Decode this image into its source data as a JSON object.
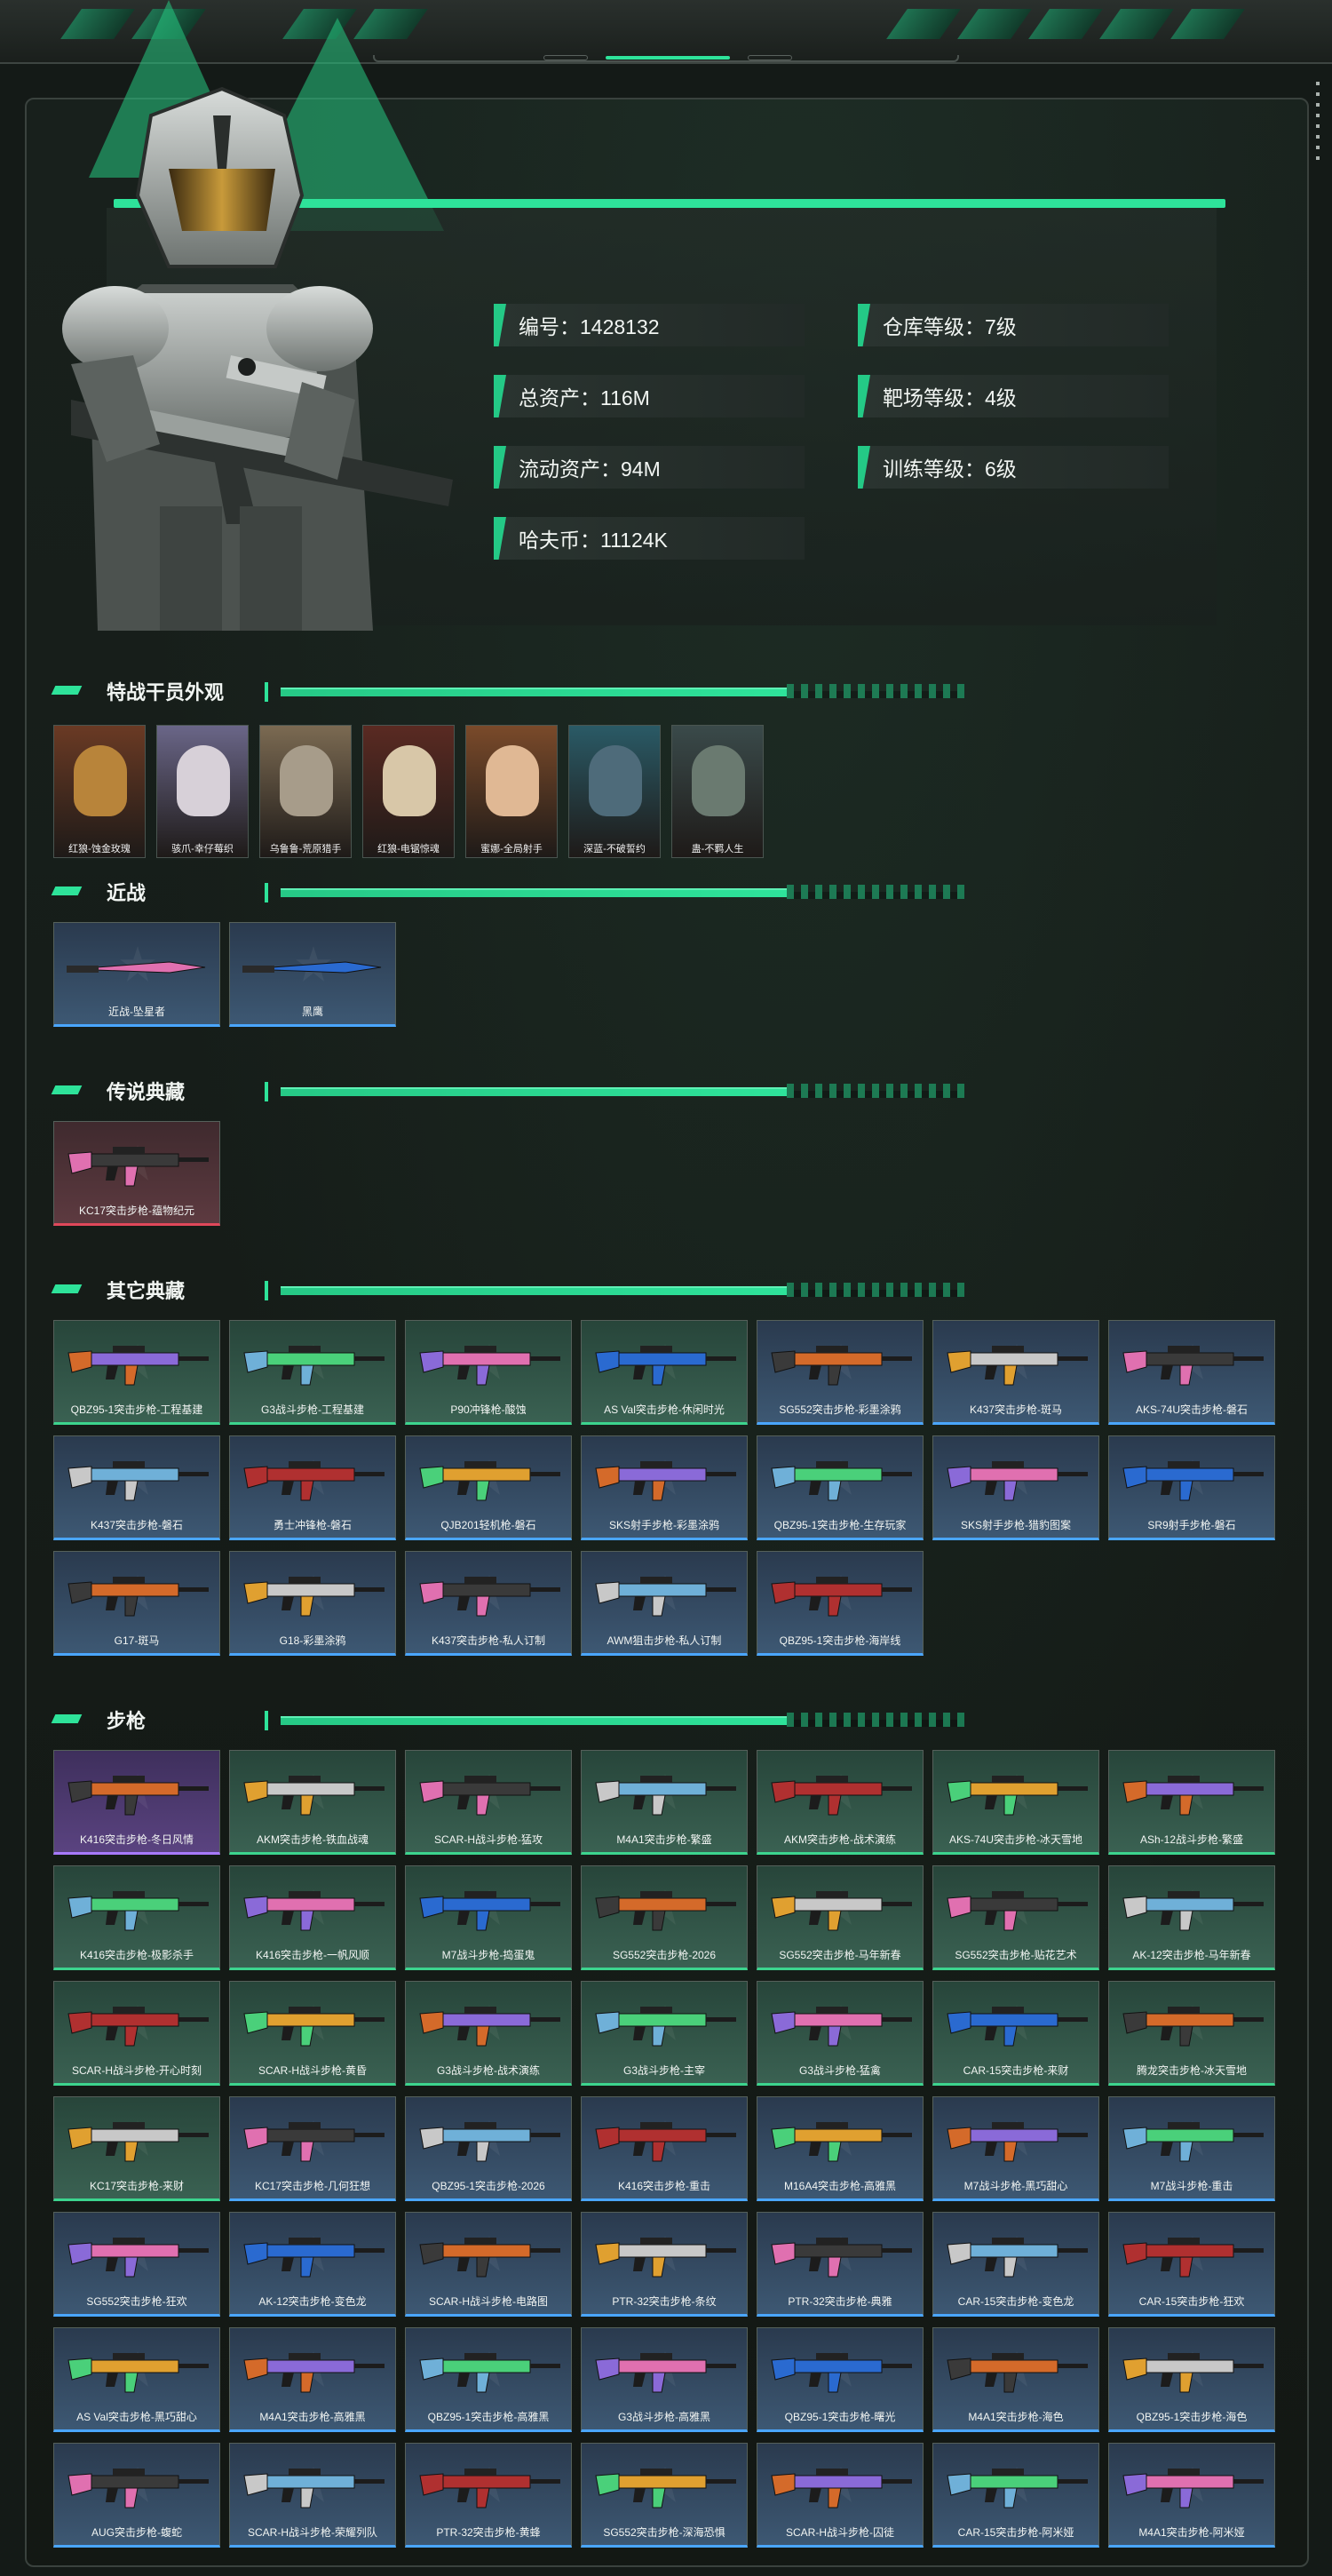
{
  "profile": {
    "stats": [
      {
        "label": "编号：1428132"
      },
      {
        "label": "仓库等级：7级"
      },
      {
        "label": "总资产：116M"
      },
      {
        "label": "靶场等级：4级"
      },
      {
        "label": "流动资产：94M"
      },
      {
        "label": "训练等级：6级"
      },
      {
        "label": "哈夫币：11124K"
      }
    ]
  },
  "sections": {
    "operators": {
      "title": "特战干员外观"
    },
    "melee": {
      "title": "近战"
    },
    "legend": {
      "title": "传说典藏"
    },
    "other": {
      "title": "其它典藏"
    },
    "rifles": {
      "title": "步枪"
    }
  },
  "operators": [
    {
      "name": "红狼-蚀金玫瑰"
    },
    {
      "name": "骇爪-幸仔莓织"
    },
    {
      "name": "乌鲁鲁-荒原猎手"
    },
    {
      "name": "红狼-电锯惊魂"
    },
    {
      "name": "蜜娜-全局射手"
    },
    {
      "name": "深蓝-不破誓约"
    },
    {
      "name": "蛊-不羁人生"
    }
  ],
  "melee": [
    {
      "name": "近战-坠星者",
      "rarity": "blue"
    },
    {
      "name": "黑鹰",
      "rarity": "blue"
    }
  ],
  "legend": [
    {
      "name": "KC17突击步枪-蕴物纪元",
      "rarity": "red"
    }
  ],
  "other": [
    {
      "name": "QBZ95-1突击步枪-工程基建",
      "rarity": "green"
    },
    {
      "name": "G3战斗步枪-工程基建",
      "rarity": "green"
    },
    {
      "name": "P90冲锋枪-酸蚀",
      "rarity": "green"
    },
    {
      "name": "AS Val突击步枪-休闲时光",
      "rarity": "green"
    },
    {
      "name": "SG552突击步枪-彩墨涂鸦",
      "rarity": "blue"
    },
    {
      "name": "K437突击步枪-斑马",
      "rarity": "blue"
    },
    {
      "name": "AKS-74U突击步枪-磐石",
      "rarity": "blue"
    },
    {
      "name": "K437突击步枪-磐石",
      "rarity": "blue"
    },
    {
      "name": "勇士冲锋枪-磐石",
      "rarity": "blue"
    },
    {
      "name": "QJB201轻机枪-磐石",
      "rarity": "blue"
    },
    {
      "name": "SKS射手步枪-彩墨涂鸦",
      "rarity": "blue"
    },
    {
      "name": "QBZ95-1突击步枪-生存玩家",
      "rarity": "blue"
    },
    {
      "name": "SKS射手步枪-猎豹图案",
      "rarity": "blue"
    },
    {
      "name": "SR9射手步枪-磐石",
      "rarity": "blue"
    },
    {
      "name": "G17-斑马",
      "rarity": "blue"
    },
    {
      "name": "G18-彩墨涂鸦",
      "rarity": "blue"
    },
    {
      "name": "K437突击步枪-私人订制",
      "rarity": "blue"
    },
    {
      "name": "AWM狙击步枪-私人订制",
      "rarity": "blue"
    },
    {
      "name": "QBZ95-1突击步枪-海岸线",
      "rarity": "blue"
    }
  ],
  "rifles": [
    {
      "name": "K416突击步枪-冬日风情",
      "rarity": "purple"
    },
    {
      "name": "AKM突击步枪-铁血战魂",
      "rarity": "green"
    },
    {
      "name": "SCAR-H战斗步枪-猛攻",
      "rarity": "green"
    },
    {
      "name": "M4A1突击步枪-繁盛",
      "rarity": "green"
    },
    {
      "name": "AKM突击步枪-战术演练",
      "rarity": "green"
    },
    {
      "name": "AKS-74U突击步枪-冰天雪地",
      "rarity": "green"
    },
    {
      "name": "ASh-12战斗步枪-繁盛",
      "rarity": "green"
    },
    {
      "name": "K416突击步枪-极影杀手",
      "rarity": "green"
    },
    {
      "name": "K416突击步枪-一帆风顺",
      "rarity": "green"
    },
    {
      "name": "M7战斗步枪-捣蛋鬼",
      "rarity": "green"
    },
    {
      "name": "SG552突击步枪-2026",
      "rarity": "green"
    },
    {
      "name": "SG552突击步枪-马年新春",
      "rarity": "green"
    },
    {
      "name": "SG552突击步枪-贴花艺术",
      "rarity": "green"
    },
    {
      "name": "AK-12突击步枪-马年新春",
      "rarity": "green"
    },
    {
      "name": "SCAR-H战斗步枪-开心时刻",
      "rarity": "green"
    },
    {
      "name": "SCAR-H战斗步枪-黄昏",
      "rarity": "green"
    },
    {
      "name": "G3战斗步枪-战术演练",
      "rarity": "green"
    },
    {
      "name": "G3战斗步枪-主宰",
      "rarity": "green"
    },
    {
      "name": "G3战斗步枪-猛禽",
      "rarity": "green"
    },
    {
      "name": "CAR-15突击步枪-来财",
      "rarity": "green"
    },
    {
      "name": "腾龙突击步枪-冰天雪地",
      "rarity": "green"
    },
    {
      "name": "KC17突击步枪-来财",
      "rarity": "green"
    },
    {
      "name": "KC17突击步枪-几何狂想",
      "rarity": "blue"
    },
    {
      "name": "QBZ95-1突击步枪-2026",
      "rarity": "blue"
    },
    {
      "name": "K416突击步枪-重击",
      "rarity": "blue"
    },
    {
      "name": "M16A4突击步枪-高雅黑",
      "rarity": "blue"
    },
    {
      "name": "M7战斗步枪-黑巧甜心",
      "rarity": "blue"
    },
    {
      "name": "M7战斗步枪-重击",
      "rarity": "blue"
    },
    {
      "name": "SG552突击步枪-狂欢",
      "rarity": "blue"
    },
    {
      "name": "AK-12突击步枪-变色龙",
      "rarity": "blue"
    },
    {
      "name": "SCAR-H战斗步枪-电路图",
      "rarity": "blue"
    },
    {
      "name": "PTR-32突击步枪-条纹",
      "rarity": "blue"
    },
    {
      "name": "PTR-32突击步枪-典雅",
      "rarity": "blue"
    },
    {
      "name": "CAR-15突击步枪-变色龙",
      "rarity": "blue"
    },
    {
      "name": "CAR-15突击步枪-狂欢",
      "rarity": "blue"
    },
    {
      "name": "AS Val突击步枪-黑巧甜心",
      "rarity": "blue"
    },
    {
      "name": "M4A1突击步枪-高雅黑",
      "rarity": "blue"
    },
    {
      "name": "QBZ95-1突击步枪-高雅黑",
      "rarity": "blue"
    },
    {
      "name": "G3战斗步枪-高雅黑",
      "rarity": "blue"
    },
    {
      "name": "QBZ95-1突击步枪-曙光",
      "rarity": "blue"
    },
    {
      "name": "M4A1突击步枪-海色",
      "rarity": "blue"
    },
    {
      "name": "QBZ95-1突击步枪-海色",
      "rarity": "blue"
    },
    {
      "name": "AUG突击步枪-蝮蛇",
      "rarity": "blue"
    },
    {
      "name": "SCAR-H战斗步枪-荣耀列队",
      "rarity": "blue"
    },
    {
      "name": "PTR-32突击步枪-黄蜂",
      "rarity": "blue"
    },
    {
      "name": "SG552突击步枪-深海恐惧",
      "rarity": "blue"
    },
    {
      "name": "SCAR-H战斗步枪-囚徒",
      "rarity": "blue"
    },
    {
      "name": "CAR-15突击步枪-阿米娅",
      "rarity": "blue"
    },
    {
      "name": "M4A1突击步枪-阿米娅",
      "rarity": "blue"
    }
  ]
}
